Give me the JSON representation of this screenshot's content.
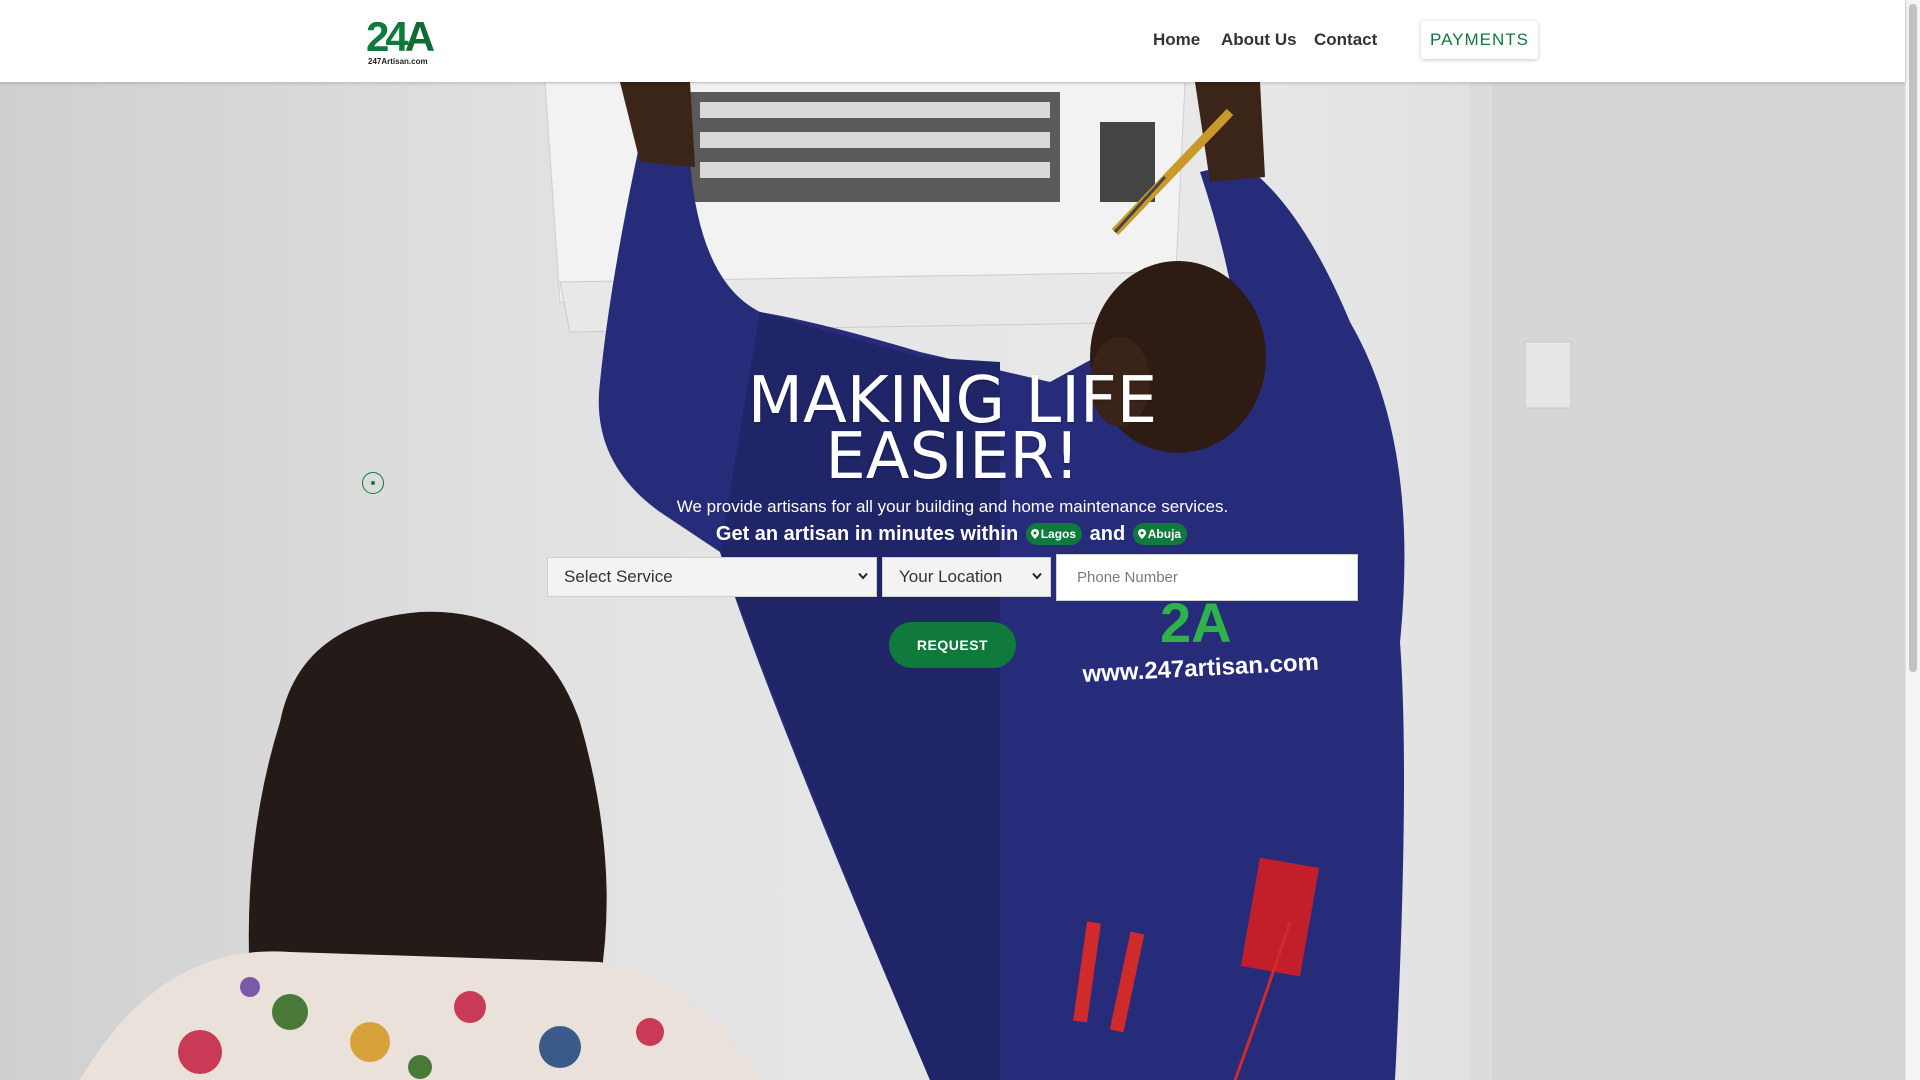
{
  "brand": {
    "logo_mark_primary": "24",
    "logo_mark_secondary": "A",
    "logo_caption": "247Artisan.com",
    "accent_color": "#0f7a3b"
  },
  "nav": {
    "home": "Home",
    "about": "About Us",
    "contact": "Contact",
    "payments": "PAYMENTS"
  },
  "hero": {
    "headline_line1": "MAKING LIFE",
    "headline_line2": "EASIER!",
    "tagline": "We provide artisans for all your building and home maintenance services.",
    "subline_prefix": "Get an artisan in minutes within",
    "subline_joiner": "and",
    "location_1": "Lagos",
    "location_2": "Abuja",
    "shirt_logo": "2A",
    "shirt_url": "www.247artisan.com"
  },
  "form": {
    "service_select": "Select Service",
    "location_select": "Your Location",
    "phone_placeholder": "Phone Number",
    "submit_label": "REQUEST"
  }
}
